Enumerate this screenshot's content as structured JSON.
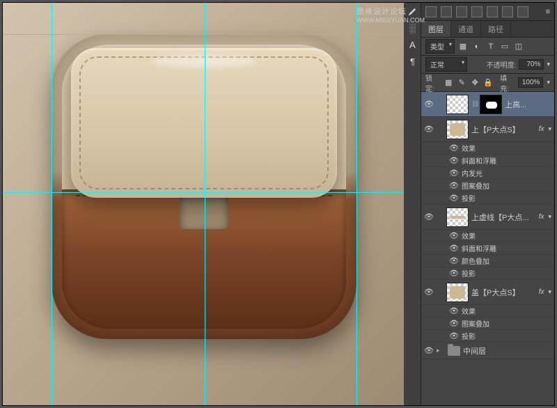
{
  "watermark": {
    "text": "思缘设计论坛",
    "url": "WWW.MISSYUAN.COM"
  },
  "tabs": {
    "t1": "图层",
    "t2": "通道",
    "t3": "路径"
  },
  "filter": {
    "kind": "类型"
  },
  "blend": {
    "mode": "正常",
    "opacity_label": "不透明度:",
    "opacity": "70%"
  },
  "lock": {
    "label": "锁定:",
    "fill_label": "填充:",
    "fill": "100%"
  },
  "layers": {
    "l1": {
      "name": "上高..."
    },
    "l2": {
      "name": "上【P大点S】",
      "fx": "fx"
    },
    "l2_effects_label": "效果",
    "l2_e1": "斜面和浮雕",
    "l2_e2": "内发光",
    "l2_e3": "图案叠加",
    "l2_e4": "投影",
    "l3": {
      "name": "上虚线【P大点...",
      "fx": "fx"
    },
    "l3_effects_label": "效果",
    "l3_e1": "斜面和浮雕",
    "l3_e2": "颜色叠加",
    "l3_e3": "投影",
    "l4": {
      "name": "盖【P大点S】",
      "fx": "fx"
    },
    "l4_effects_label": "效果",
    "l4_e1": "图案叠加",
    "l4_e2": "投影",
    "l5": {
      "name": "中间层"
    }
  }
}
